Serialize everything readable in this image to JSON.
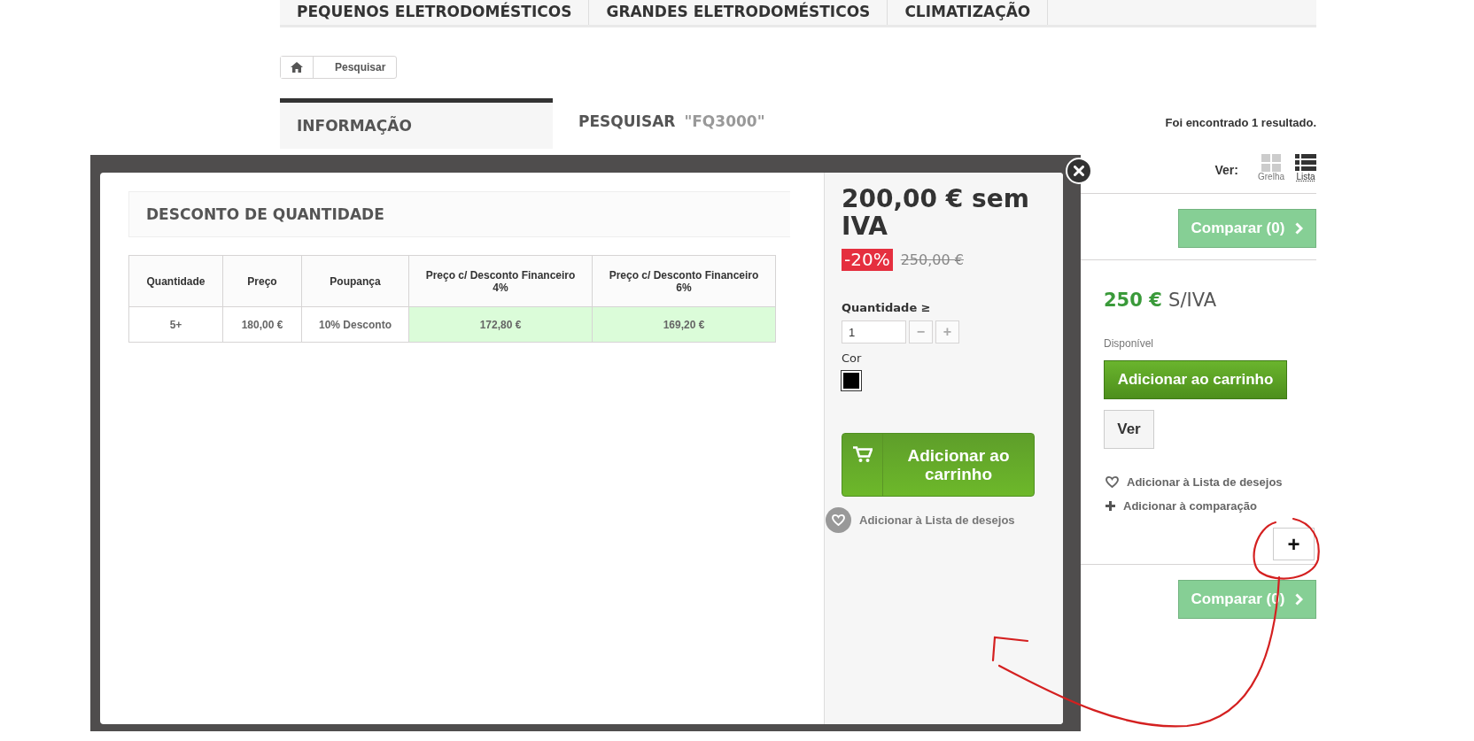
{
  "nav": {
    "tabs": [
      {
        "label": "PEQUENOS ELETRODOMÉSTICOS"
      },
      {
        "label": "GRANDES ELETRODOMÉSTICOS"
      },
      {
        "label": "CLIMATIZAÇÃO"
      }
    ]
  },
  "breadcrumb": {
    "current": "Pesquisar"
  },
  "sidebar": {
    "title": "INFORMAÇÃO"
  },
  "search": {
    "label": "PESQUISAR",
    "query": "\"FQ3000\"",
    "result_count": "Foi encontrado 1 resultado."
  },
  "view": {
    "label": "Ver:",
    "options": [
      {
        "label": "Grelha",
        "selected": false
      },
      {
        "label": "Lista",
        "selected": true
      }
    ]
  },
  "compare_buttons": [
    "Comparar (0)",
    "Comparar (0)"
  ],
  "product": {
    "price": "250 €",
    "tax_label": "S/IVA",
    "availability": "Disponível",
    "add_to_cart": "Adicionar ao carrinho",
    "view_button": "Ver",
    "wishlist_link": "Adicionar à Lista de desejos",
    "compare_link": "Adicionar à comparação",
    "plus_button": "+"
  },
  "modal": {
    "heading": "DESCONTO DE QUANTIDADE",
    "table": {
      "columns": [
        {
          "label": "Quantidade"
        },
        {
          "label": "Preço"
        },
        {
          "label": "Poupança"
        },
        {
          "label": "Preço c/ Desconto Financeiro 4%"
        },
        {
          "label": "Preço c/ Desconto Financeiro 6%"
        }
      ],
      "rows": [
        [
          {
            "text": "5+",
            "highlighted": false
          },
          {
            "text": "180,00 €",
            "highlighted": false
          },
          {
            "text": "10% Desconto",
            "highlighted": false
          },
          {
            "text": "172,80 €",
            "highlighted": true
          },
          {
            "text": "169,20 €",
            "highlighted": true
          }
        ]
      ]
    },
    "price": "200,00 € sem IVA",
    "discount": "-20%",
    "old_price": "250,00 €",
    "quantity_label": "Quantidade ≥",
    "quantity": "1",
    "minus": "−",
    "plus": "+",
    "color_label": "Cor",
    "colors": [
      {
        "color": "#000000",
        "selected": true
      }
    ],
    "add_to_cart": "Adicionar ao carrinho",
    "wishlist_link": "Adicionar à Lista de desejos"
  }
}
